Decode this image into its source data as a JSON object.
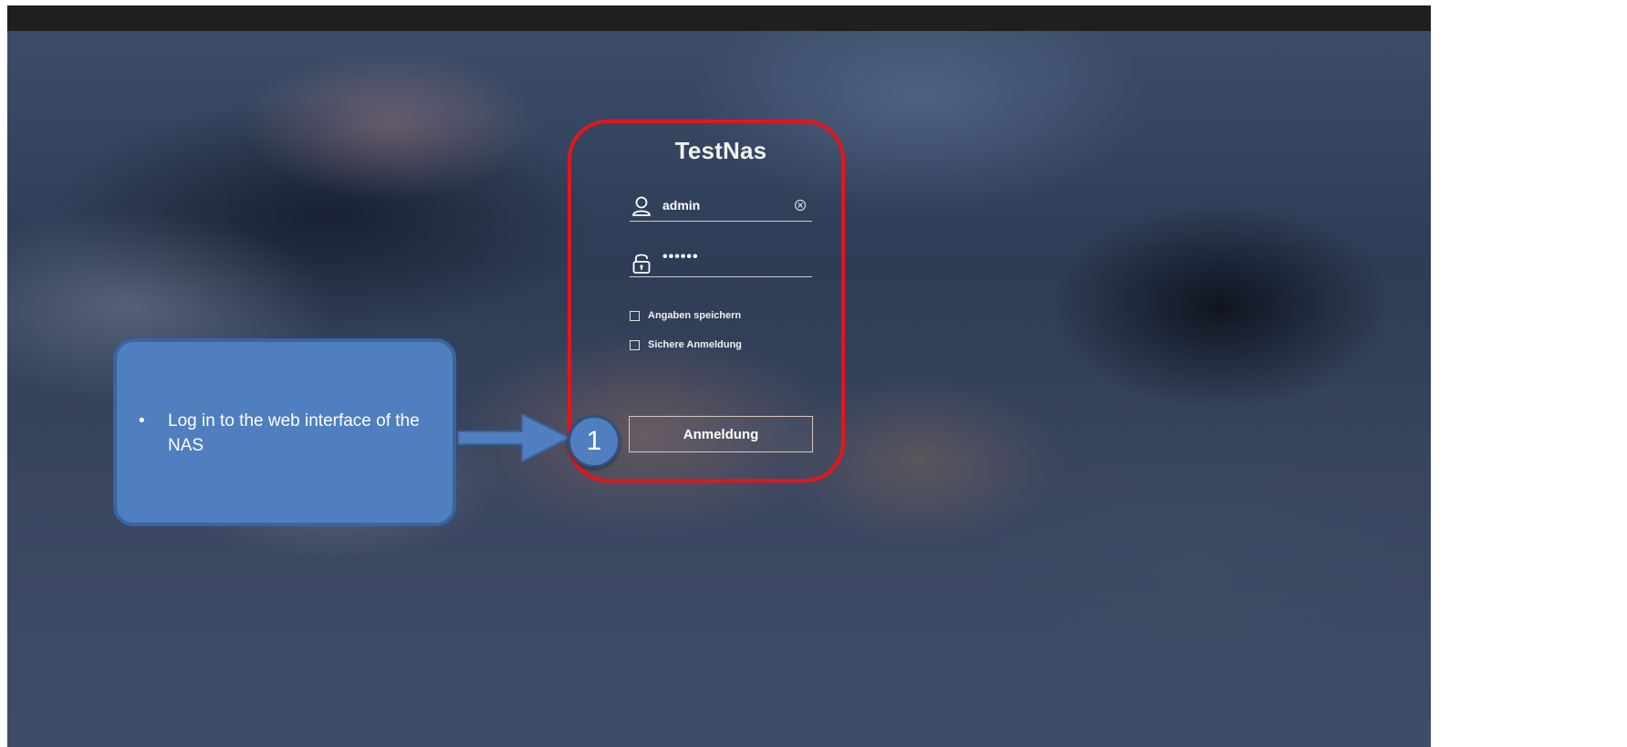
{
  "login": {
    "title": "TestNas",
    "username": "admin",
    "password_masked": "••••••",
    "remember_label": "Angaben speichern",
    "secure_label": "Sichere Anmeldung",
    "login_button": "Anmeldung"
  },
  "annotation": {
    "bullet": "•",
    "callout_text": "Log in to the web interface of the NAS",
    "step_number": "1"
  },
  "icons": {
    "user": "user-icon",
    "lock": "lock-icon",
    "clear": "clear-icon",
    "arrow": "arrow-icon"
  },
  "colors": {
    "highlight": "#e8141b",
    "callout_fill": "#4f7fbf",
    "callout_border": "#3a64a0",
    "topbar": "#1f1f20"
  }
}
